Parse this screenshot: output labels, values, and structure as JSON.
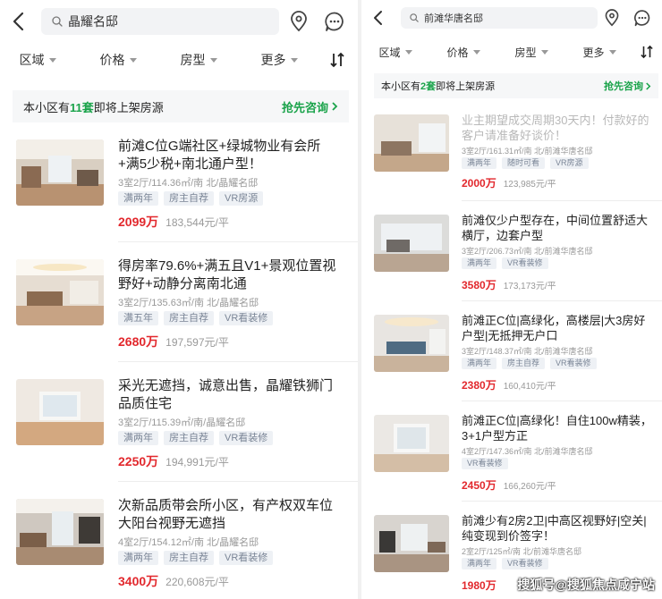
{
  "left": {
    "search": {
      "query": "晶耀名邸"
    },
    "filters": [
      "区域",
      "价格",
      "房型",
      "更多"
    ],
    "notice": {
      "prefix": "本小区有",
      "count": "11套",
      "suffix": "即将上架房源",
      "cta": "抢先咨询"
    },
    "listings": [
      {
        "title": "前滩C位G端社区+绿城物业有会所+满5少税+南北通户型！",
        "meta": "3室2厅/114.36㎡/南 北/晶耀名邸",
        "tags": [
          "满两年",
          "房主自荐",
          "VR房源"
        ],
        "price": "2099万",
        "unit_price": "183,544元/平"
      },
      {
        "title": "得房率79.6%+满五且V1+景观位置视野好+动静分离南北通",
        "meta": "3室2厅/135.63㎡/南 北/晶耀名邸",
        "tags": [
          "满五年",
          "房主自荐",
          "VR看装修"
        ],
        "price": "2680万",
        "unit_price": "197,597元/平"
      },
      {
        "title": "采光无遮挡，诚意出售，晶耀铁狮门品质住宅",
        "meta": "3室2厅/115.39㎡/南/晶耀名邸",
        "tags": [
          "满两年",
          "房主自荐",
          "VR看装修"
        ],
        "price": "2250万",
        "unit_price": "194,991元/平"
      },
      {
        "title": "次新品质带会所小区，有产权双车位大阳台视野无遮挡",
        "meta": "4室2厅/154.12㎡/南 北/晶耀名邸",
        "tags": [
          "满两年",
          "房主自荐",
          "VR看装修"
        ],
        "price": "3400万",
        "unit_price": "220,608元/平"
      }
    ]
  },
  "right": {
    "search": {
      "query": "前滩华唐名邸"
    },
    "filters": [
      "区域",
      "价格",
      "房型",
      "更多"
    ],
    "notice": {
      "prefix": "本小区有",
      "count": "2套",
      "suffix": "即将上架房源",
      "cta": "抢先咨询"
    },
    "listings": [
      {
        "title": "业主期望成交周期30天内！付款好的客户请准备好谈价！",
        "meta": "3室2厅/161.31㎡/南 北/前滩华唐名邸",
        "tags": [
          "满两年",
          "随时可看",
          "VR房源"
        ],
        "price": "2000万",
        "unit_price": "123,985元/平",
        "title_color": "#b9b9b9"
      },
      {
        "title": "前滩仅少户型存在，中间位置舒适大横厅，边套户型",
        "meta": "3室2厅/206.73㎡/南 北/前滩华唐名邸",
        "tags": [
          "满两年",
          "VR看装修"
        ],
        "price": "3580万",
        "unit_price": "173,173元/平"
      },
      {
        "title": "前滩正C位|高绿化，高楼层|大3房好户型|无抵押无户口",
        "meta": "3室2厅/148.37㎡/南 北/前滩华唐名邸",
        "tags": [
          "满两年",
          "房主自荐",
          "VR看装修"
        ],
        "price": "2380万",
        "unit_price": "160,410元/平"
      },
      {
        "title": "前滩正C位|高绿化！自住100w精装，3+1户型方正",
        "meta": "4室2厅/147.36㎡/南 北/前滩华唐名邸",
        "tags": [
          "VR看装修"
        ],
        "price": "2450万",
        "unit_price": "166,260元/平"
      },
      {
        "title": "前滩少有2房2卫|中高区视野好|空关|纯变现到价签字！",
        "meta": "2室2厅/125㎡/南 北/前滩华唐名邸",
        "tags": [
          "满两年",
          "VR看装修"
        ],
        "price": "1980万",
        "unit_price": ""
      }
    ]
  },
  "watermark": "搜狐号@搜狐焦点咸宁站",
  "colors": {
    "price": "#e2282d",
    "accent": "#1aa34a",
    "tag_bg": "#eef1f5",
    "tag_text": "#7a8596"
  }
}
